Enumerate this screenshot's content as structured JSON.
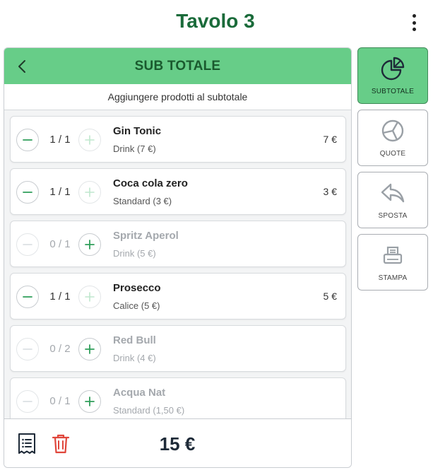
{
  "header": {
    "title": "Tavolo 3"
  },
  "panel": {
    "title": "SUB TOTALE",
    "subtitle": "Aggiungere prodotti al subtotale"
  },
  "items": [
    {
      "name": "Gin Tonic",
      "variant": "Drink (7 €)",
      "qty": "1 / 1",
      "price": "7 €",
      "enabled": true
    },
    {
      "name": "Coca cola zero",
      "variant": "Standard (3 €)",
      "qty": "1 / 1",
      "price": "3 €",
      "enabled": true
    },
    {
      "name": "Spritz Aperol",
      "variant": "Drink (5 €)",
      "qty": "0 / 1",
      "price": "",
      "enabled": false
    },
    {
      "name": "Prosecco",
      "variant": "Calice (5 €)",
      "qty": "1 / 1",
      "price": "5 €",
      "enabled": true
    },
    {
      "name": "Red Bull",
      "variant": "Drink (4 €)",
      "qty": "0 / 2",
      "price": "",
      "enabled": false
    },
    {
      "name": "Acqua Nat",
      "variant": "Standard (1,50 €)",
      "qty": "0 / 1",
      "price": "",
      "enabled": false
    }
  ],
  "footer": {
    "total": "15 €"
  },
  "sidebar": {
    "subtotale": "SUBTOTALE",
    "quote": "QUOTE",
    "sposta": "SPOSTA",
    "stampa": "STAMPA"
  },
  "colors": {
    "accent": "#67cd88",
    "title_green": "#1a6b3a",
    "delete_red": "#e0463b"
  },
  "icons": [
    "kebab-menu-icon",
    "back-arrow-icon",
    "minus-icon",
    "plus-icon",
    "receipt-icon",
    "trash-icon",
    "pie-chart-icon",
    "circle-split-icon",
    "reply-arrow-icon",
    "printer-icon"
  ]
}
